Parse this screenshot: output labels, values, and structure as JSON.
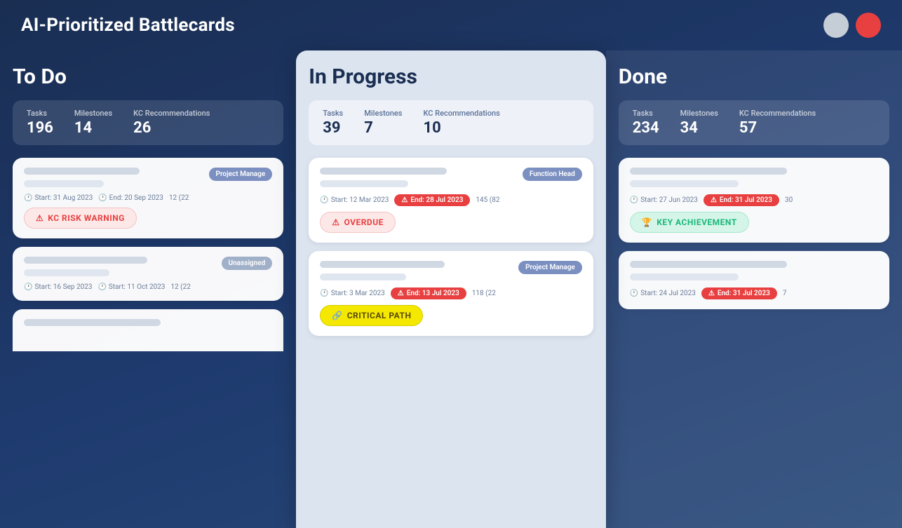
{
  "header": {
    "title": "AI-Prioritized Battlecards",
    "icon_gray": "user-icon",
    "icon_red": "notification-icon"
  },
  "columns": {
    "todo": {
      "heading": "To Do",
      "stats": {
        "tasks_label": "Tasks",
        "tasks_value": "196",
        "milestones_label": "Milestones",
        "milestones_value": "14",
        "kc_label": "KC Recommendations",
        "kc_value": "26"
      },
      "cards": [
        {
          "tag": "Project Manage",
          "tag_class": "tag-project",
          "start": "Start:  31 Aug 2023",
          "end_label": "End: 20 Sep 2023",
          "end_overdue": false,
          "count": "12 (22",
          "badge": "KC RISK WARNING",
          "badge_class": "badge-warning"
        },
        {
          "tag": "Unassigned",
          "tag_class": "tag-unassigned",
          "start": "Start:  16 Sep 2023",
          "end_label": "Start: 11 Oct 2023",
          "end_overdue": false,
          "count": "12 (22",
          "badge": null
        }
      ]
    },
    "inprogress": {
      "heading": "In Progress",
      "stats": {
        "tasks_label": "Tasks",
        "tasks_value": "39",
        "milestones_label": "Milestones",
        "milestones_value": "7",
        "kc_label": "KC Recommendations",
        "kc_value": "10"
      },
      "cards": [
        {
          "tag": "Function Head",
          "tag_class": "tag-function",
          "start": "Start:  12 Mar 2023",
          "end_label": "End: 28 Jul 2023",
          "end_overdue": true,
          "count": "145 (82",
          "badge": "OVERDUE",
          "badge_class": "badge-overdue"
        },
        {
          "tag": "Project Manage",
          "tag_class": "tag-project",
          "start": "Start:  3 Mar 2023",
          "end_label": "End: 13 Jul 2023",
          "end_overdue": true,
          "count": "118 (22",
          "badge": "CRITICAL PATH",
          "badge_class": "badge-critical"
        }
      ]
    },
    "done": {
      "heading": "Done",
      "stats": {
        "tasks_label": "Tasks",
        "tasks_value": "234",
        "milestones_label": "Milestones",
        "milestones_value": "34",
        "kc_label": "KC Recommendations",
        "kc_value": "57"
      },
      "cards": [
        {
          "tag": null,
          "start": "Start:  27 Jun 2023",
          "end_label": "End: 31 Jul 2023",
          "end_overdue": true,
          "count": "30",
          "badge": "KEY ACHIEVEMENT",
          "badge_class": "badge-achievement"
        },
        {
          "tag": null,
          "start": "Start:  24 Jul 2023",
          "end_label": "End: 31 Jul 2023",
          "end_overdue": true,
          "count": "7",
          "badge": null
        }
      ]
    }
  }
}
